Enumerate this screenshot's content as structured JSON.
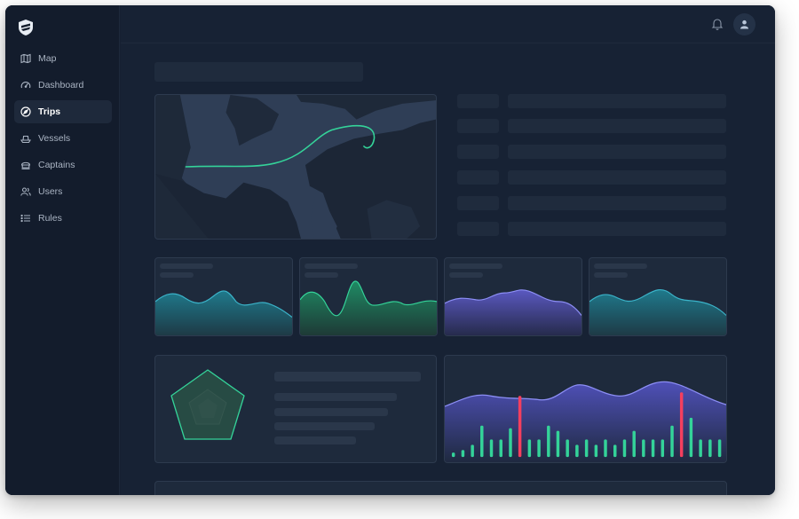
{
  "sidebar": {
    "logo_icon": "shield-logo-icon",
    "items": [
      {
        "label": "Map",
        "icon": "map-icon",
        "active": false
      },
      {
        "label": "Dashboard",
        "icon": "speedometer-icon",
        "active": false
      },
      {
        "label": "Trips",
        "icon": "compass-icon",
        "active": true
      },
      {
        "label": "Vessels",
        "icon": "ship-icon",
        "active": false
      },
      {
        "label": "Captains",
        "icon": "captain-hat-icon",
        "active": false
      },
      {
        "label": "Users",
        "icon": "users-icon",
        "active": false
      },
      {
        "label": "Rules",
        "icon": "list-icon",
        "active": false
      }
    ]
  },
  "header": {
    "notifications_icon": "bell-icon",
    "avatar_icon": "user-icon"
  },
  "colors": {
    "background": "#162032",
    "sidebar": "#131c2c",
    "accent_green": "#34d399",
    "accent_teal": "#3bb3c9",
    "accent_purple": "#7b7ff0",
    "accent_red": "#f43f5e"
  }
}
